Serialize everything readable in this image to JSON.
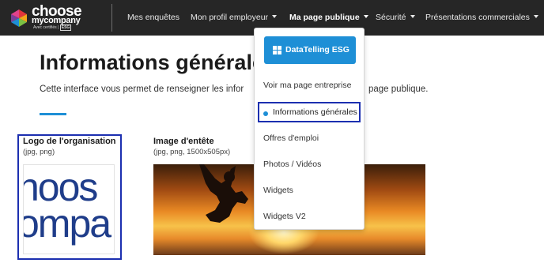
{
  "brand": {
    "name_top": "choose",
    "name_bottom": "mycompany",
    "tagline_prefix": "Avec certifiés |",
    "tagline_badge": "ESG"
  },
  "nav": {
    "items": [
      {
        "label": "Mes enquêtes",
        "has_dropdown": false,
        "active": false
      },
      {
        "label": "Mon profil employeur",
        "has_dropdown": true,
        "active": false
      },
      {
        "label": "Ma page publique",
        "has_dropdown": true,
        "active": true
      },
      {
        "label": "Sécurité",
        "has_dropdown": true,
        "active": false
      },
      {
        "label": "Présentations commerciales",
        "has_dropdown": true,
        "active": false
      }
    ]
  },
  "page": {
    "title": "Informations générales",
    "intro_start": "Cette interface vous permet de renseigner les infor",
    "intro_end": "page publique."
  },
  "logo_field": {
    "label": "Logo de l'organisation",
    "hint": "(jpg, png)",
    "preview_line1": "hoos",
    "preview_line2": "ompa"
  },
  "header_image_field": {
    "label": "Image d'entête",
    "hint": "(jpg, png, 1500x505px)"
  },
  "dropdown": {
    "button_label": "DataTelling ESG",
    "items": [
      {
        "label": "Voir ma page entreprise",
        "selected": false
      },
      {
        "label": "Informations générales",
        "selected": true
      },
      {
        "label": "Offres d'emploi",
        "selected": false
      },
      {
        "label": "Photos / Vidéos",
        "selected": false
      },
      {
        "label": "Widgets",
        "selected": false
      },
      {
        "label": "Widgets V2",
        "selected": false
      }
    ]
  },
  "colors": {
    "nav_background": "#262626",
    "accent_blue": "#1e8fd6",
    "highlight_border": "#1c2fb0",
    "logo_text": "#1f3d8a"
  }
}
